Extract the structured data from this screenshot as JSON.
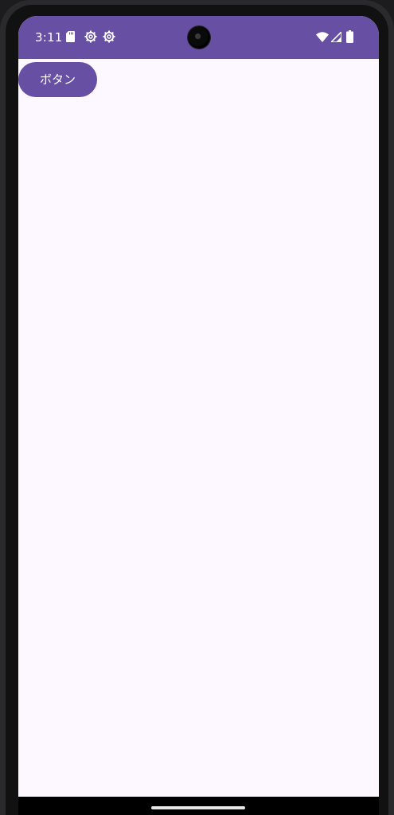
{
  "status_bar": {
    "time": "3:11",
    "left_icons": [
      "sd-card-icon",
      "settings-gear-icon",
      "settings-gear-icon"
    ],
    "right_icons": [
      "wifi-icon",
      "cellular-signal-icon",
      "battery-icon"
    ],
    "background_color": "#6750a4"
  },
  "main": {
    "button_label": "ボタン",
    "button_color": "#6750a4",
    "background_color": "#fdf7ff"
  }
}
